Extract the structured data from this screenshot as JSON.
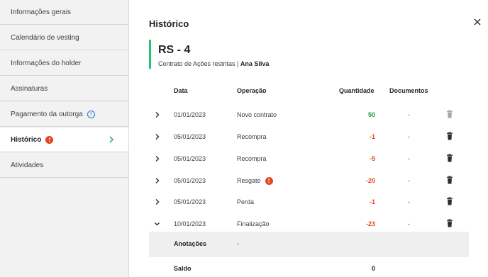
{
  "sidebar": {
    "items": [
      {
        "label": "Informações gerais"
      },
      {
        "label": "Calendário de vesting"
      },
      {
        "label": "Informações do holder"
      },
      {
        "label": "Assinaturas"
      },
      {
        "label": "Pagamento da outorga",
        "icon": "info-icon"
      },
      {
        "label": "Histórico",
        "icon": "warning-icon",
        "active": true
      },
      {
        "label": "Atividades"
      }
    ]
  },
  "header": {
    "title": "Histórico",
    "close_icon": "close-icon"
  },
  "card": {
    "id": "RS - 4",
    "contract": "Contrato de Ações restritas | ",
    "holder": "Ana Silva",
    "accent": "#21c46e"
  },
  "table": {
    "columns": {
      "date": "Data",
      "operation": "Operação",
      "quantity": "Quantidade",
      "documents": "Documentos"
    },
    "rows": [
      {
        "date": "01/01/2023",
        "operation": "Novo contrato",
        "quantity": "50",
        "documents": "-",
        "expanded": false,
        "delete_enabled": false
      },
      {
        "date": "05/01/2023",
        "operation": "Recompra",
        "quantity": "-1",
        "documents": "-",
        "expanded": false,
        "delete_enabled": true
      },
      {
        "date": "05/01/2023",
        "operation": "Recompra",
        "quantity": "-5",
        "documents": "-",
        "expanded": false,
        "delete_enabled": true
      },
      {
        "date": "05/01/2023",
        "operation": "Resgate",
        "quantity": "-20",
        "documents": "-",
        "expanded": false,
        "delete_enabled": true,
        "warning": true
      },
      {
        "date": "05/01/2023",
        "operation": "Perda",
        "quantity": "-1",
        "documents": "-",
        "expanded": false,
        "delete_enabled": true
      },
      {
        "date": "10/01/2023",
        "operation": "Finalização",
        "quantity": "-23",
        "documents": "-",
        "expanded": true,
        "delete_enabled": true
      }
    ],
    "notes": {
      "label": "Anotações",
      "value": "-"
    },
    "balance": {
      "label": "Saldo",
      "value": "0"
    }
  },
  "colors": {
    "positive": "#1b9a46",
    "negative": "#e2461e",
    "info": "#1e6fd9",
    "warning": "#e2461e"
  }
}
